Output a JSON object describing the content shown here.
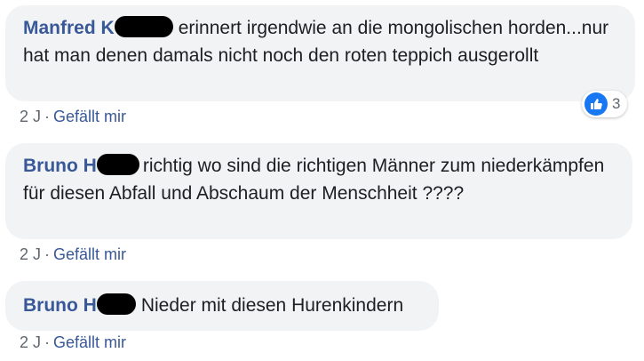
{
  "comments": [
    {
      "author": "Manfred K",
      "text": "erinnert irgendwie an die mongolischen horden...nur hat man denen damals nicht noch den roten teppich ausgerollt",
      "time": "2 J",
      "like_label": "Gefällt mir",
      "reaction_count": "3"
    },
    {
      "author": "Bruno H",
      "text": "richtig wo sind die richtigen Männer zum niederkämpfen für diesen Abfall und Abschaum der Menschheit ????",
      "time": "2 J",
      "like_label": "Gefällt mir"
    },
    {
      "author": "Bruno H",
      "text": "Nieder mit diesen Hurenkindern",
      "time": "2 J",
      "like_label": "Gefällt mir"
    }
  ],
  "separator": "·",
  "colors": {
    "author": "#385898",
    "bubble": "#f2f3f5",
    "like_badge": "#1877f2"
  },
  "icons": {
    "reaction": "thumbs-up-icon"
  }
}
